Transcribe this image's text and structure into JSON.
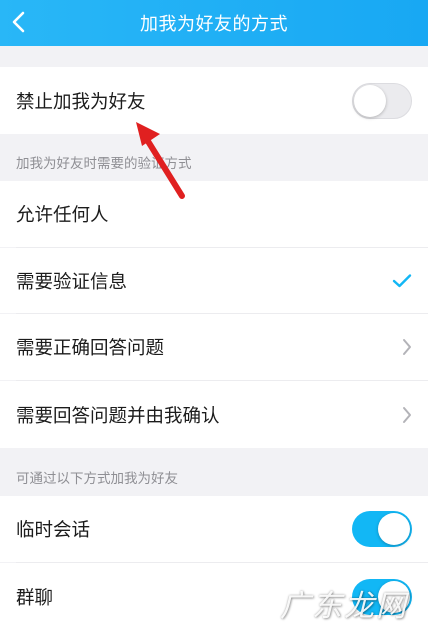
{
  "header": {
    "title": "加我为好友的方式",
    "back_icon": "chevron-left-icon"
  },
  "block_row": {
    "label": "禁止加我为好友",
    "toggle_on": false
  },
  "verify_section": {
    "label": "加我为好友时需要的验证方式",
    "options": [
      {
        "label": "允许任何人",
        "indicator": "none"
      },
      {
        "label": "需要验证信息",
        "indicator": "check-icon"
      },
      {
        "label": "需要正确回答问题",
        "indicator": "chevron-right-icon"
      },
      {
        "label": "需要回答问题并由我确认",
        "indicator": "chevron-right-icon"
      }
    ]
  },
  "channels_section": {
    "label": "可通过以下方式加我为好友",
    "items": [
      {
        "label": "临时会话",
        "toggle_on": true
      },
      {
        "label": "群聊",
        "toggle_on": true
      }
    ]
  },
  "watermark": "广东龙网",
  "colors": {
    "header": "#18a8f3",
    "accent": "#12b7f5",
    "annotation_arrow": "#e02020"
  }
}
